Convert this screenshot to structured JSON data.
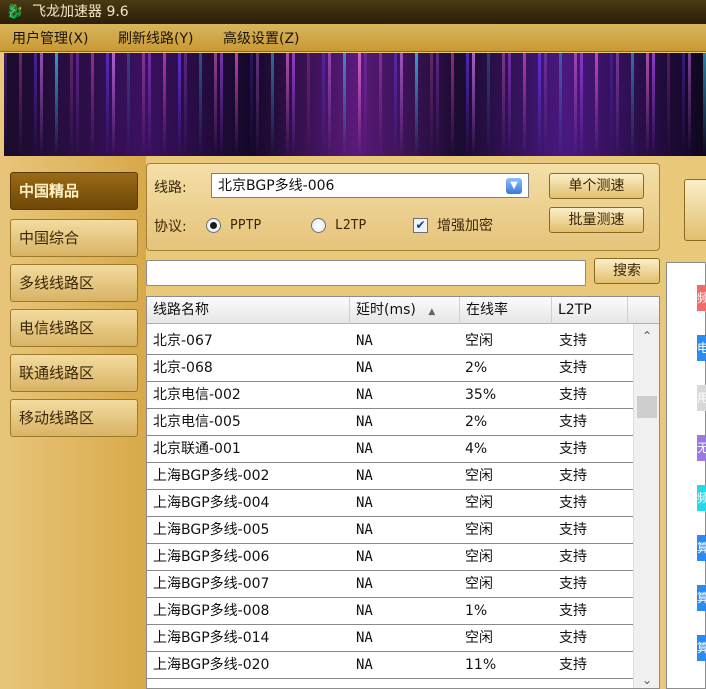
{
  "window": {
    "title": "飞龙加速器 9.6",
    "app_icon": "dragon-icon"
  },
  "menu": [
    {
      "label": "用户管理(X)"
    },
    {
      "label": "刷新线路(Y)"
    },
    {
      "label": "高级设置(Z)"
    }
  ],
  "nav": [
    {
      "label": "中国精品",
      "active": true
    },
    {
      "label": "中国综合"
    },
    {
      "label": "多线线路区"
    },
    {
      "label": "电信线路区"
    },
    {
      "label": "联通线路区"
    },
    {
      "label": "移动线路区"
    }
  ],
  "filter": {
    "route_label": "线路:",
    "route_value": "北京BGP多线-006",
    "protocol_label": "协议:",
    "pptp_label": "PPTP",
    "l2tp_label": "L2TP",
    "selected_protocol": "PPTP",
    "encrypt_label": "增强加密",
    "encrypt_checked": true,
    "single_test": "单个测速",
    "batch_test": "批量测速"
  },
  "search": {
    "value": "",
    "button": "搜索"
  },
  "table": {
    "columns": [
      "线路名称",
      "延时(ms)",
      "在线率",
      "L2TP"
    ],
    "sort_indicator": "▲",
    "rows": [
      [
        "北京-067",
        "NA",
        "空闲",
        "支持"
      ],
      [
        "北京-068",
        "NA",
        "2%",
        "支持"
      ],
      [
        "北京电信-002",
        "NA",
        "35%",
        "支持"
      ],
      [
        "北京电信-005",
        "NA",
        "2%",
        "支持"
      ],
      [
        "北京联通-001",
        "NA",
        "4%",
        "支持"
      ],
      [
        "上海BGP多线-002",
        "NA",
        "空闲",
        "支持"
      ],
      [
        "上海BGP多线-004",
        "NA",
        "空闲",
        "支持"
      ],
      [
        "上海BGP多线-005",
        "NA",
        "空闲",
        "支持"
      ],
      [
        "上海BGP多线-006",
        "NA",
        "空闲",
        "支持"
      ],
      [
        "上海BGP多线-007",
        "NA",
        "空闲",
        "支持"
      ],
      [
        "上海BGP多线-008",
        "NA",
        "1%",
        "支持"
      ],
      [
        "上海BGP多线-014",
        "NA",
        "空闲",
        "支持"
      ],
      [
        "上海BGP多线-020",
        "NA",
        "11%",
        "支持"
      ]
    ]
  },
  "right_panel": {
    "tags": [
      {
        "text": "频",
        "color": "#f06a6a"
      },
      {
        "text": "电",
        "color": "#2a8cf0"
      },
      {
        "text": "用",
        "color": "#d8d8d8"
      },
      {
        "text": "无",
        "color": "#9a7ae0"
      },
      {
        "text": "频",
        "color": "#24d8e8"
      },
      {
        "text": "算",
        "color": "#2a8cf0"
      },
      {
        "text": "算",
        "color": "#2a8cf0"
      },
      {
        "text": "算",
        "color": "#2a8cf0"
      }
    ]
  }
}
